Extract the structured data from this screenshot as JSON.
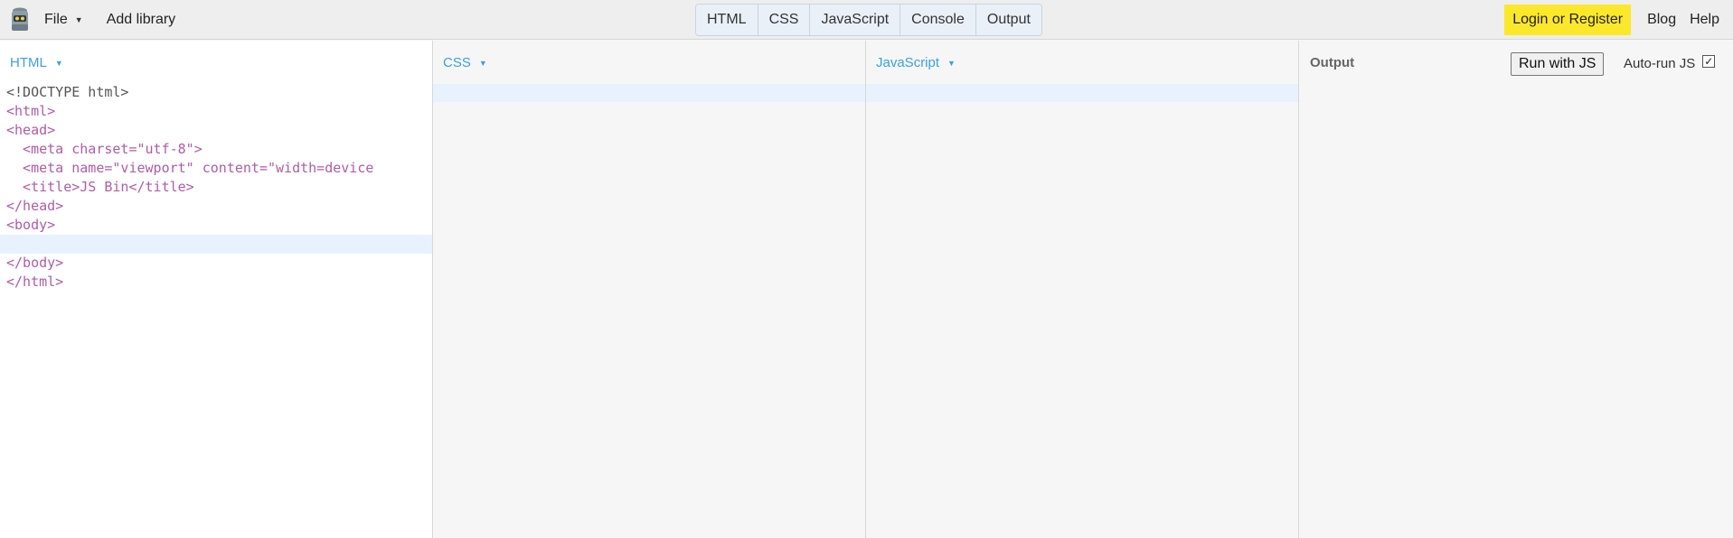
{
  "menu": {
    "file": "File",
    "add_library": "Add library"
  },
  "tabs": [
    "HTML",
    "CSS",
    "JavaScript",
    "Console",
    "Output"
  ],
  "right_menu": {
    "login": "Login or Register",
    "blog": "Blog",
    "help": "Help"
  },
  "panels": {
    "html_label": "HTML",
    "css_label": "CSS",
    "js_label": "JavaScript",
    "output_label": "Output"
  },
  "output": {
    "run_button": "Run with JS",
    "autorun_label": "Auto-run JS",
    "autorun_checked": true
  },
  "html_code": [
    "<!DOCTYPE html>",
    "<html>",
    "<head>",
    "  <meta charset=\"utf-8\">",
    "  <meta name=\"viewport\" content=\"width=device",
    "  <title>JS Bin</title>",
    "</head>",
    "<body>",
    "",
    "</body>",
    "</html>"
  ],
  "colors": {
    "login_highlight": "#fce82a",
    "panel_label": "#3ba0e8"
  }
}
